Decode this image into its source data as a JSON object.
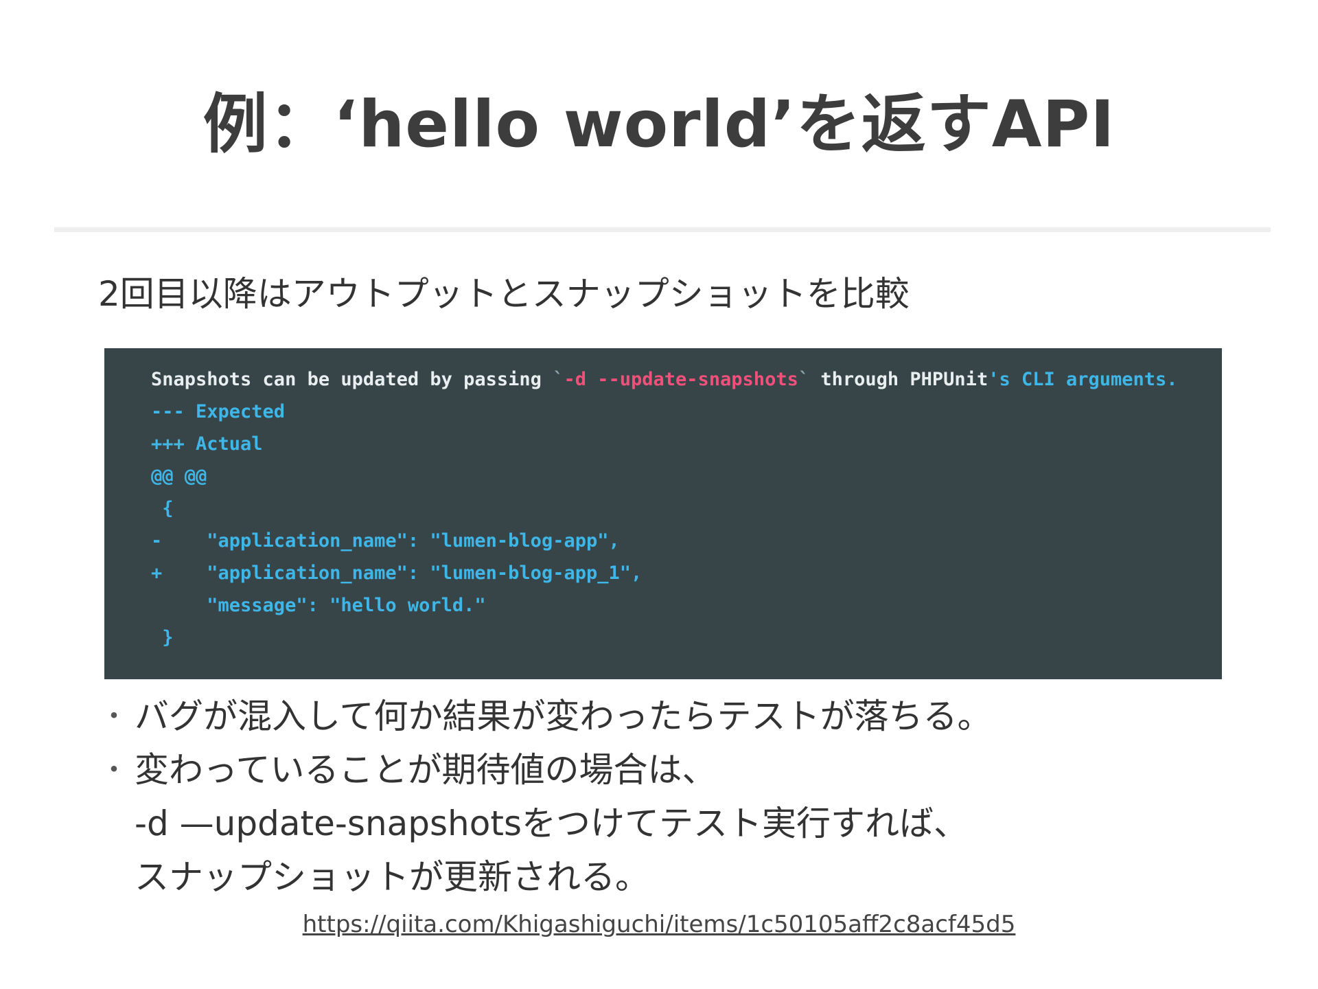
{
  "slide": {
    "title": "例：‘hello world’を返すAPI",
    "subtitle": "2回目以降はアウトプットとスナップショットを比較",
    "bullets": [
      {
        "marker": "・",
        "lines": [
          "バグが混入して何か結果が変わったらテストが落ちる。"
        ]
      },
      {
        "marker": "・",
        "lines": [
          "変わっていることが期待値の場合は、",
          "-d —update-snapshotsをつけてテスト実行すれば、",
          "スナップショットが更新される。"
        ]
      }
    ],
    "link_text": "https://qiita.com/Khigashiguchi/items/1c50105aff2c8acf45d5"
  },
  "terminal": {
    "colors": {
      "background": "#374448",
      "text": "#e9eef0",
      "flag": "#f0507a",
      "accent": "#3fb6e8"
    },
    "lines": [
      [
        {
          "text": "Snapshots can be updated by passing ",
          "color": "white"
        },
        {
          "text": "`",
          "color": "gray"
        },
        {
          "text": "-d --update-snapshots",
          "color": "red"
        },
        {
          "text": "`",
          "color": "gray"
        },
        {
          "text": " through PHPUnit",
          "color": "white"
        },
        {
          "text": "'s CLI arguments.",
          "color": "cyan"
        }
      ],
      [
        {
          "text": "--- Expected",
          "color": "cyan"
        }
      ],
      [
        {
          "text": "+++ Actual",
          "color": "cyan"
        }
      ],
      [
        {
          "text": "@@ @@",
          "color": "cyan"
        }
      ],
      [
        {
          "text": " {",
          "color": "cyan"
        }
      ],
      [
        {
          "text": "-    \"application_name\": \"lumen-blog-app\",",
          "color": "cyan"
        }
      ],
      [
        {
          "text": "+    \"application_name\": \"lumen-blog-app_1\",",
          "color": "cyan"
        }
      ],
      [
        {
          "text": "     \"message\": \"hello world.\"",
          "color": "cyan"
        }
      ],
      [
        {
          "text": " }",
          "color": "cyan"
        }
      ]
    ]
  }
}
